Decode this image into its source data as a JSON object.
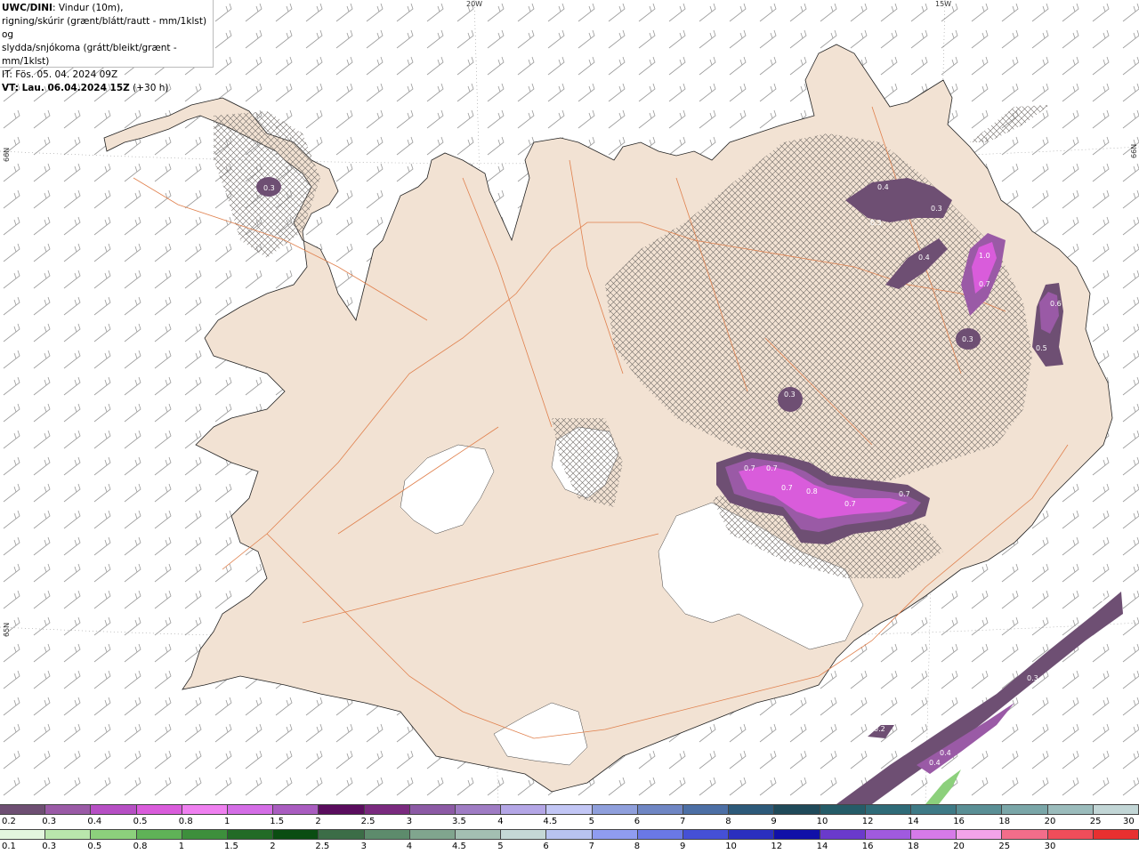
{
  "header": {
    "model": "UWC/DINI",
    "desc_1": ": Vindur (10m),",
    "desc_2": "rigning/skúrir (grænt/blátt/rautt - mm/1klst) og",
    "desc_3": "slydda/snjókoma (grátt/bleikt/grænt - mm/1klst)",
    "it": "IT: Fös. 05. 04. 2024 09Z",
    "vt_label": "VT: Lau. 06.04.2024 15Z",
    "vt_offset": " (+30 h)"
  },
  "graticule": {
    "lon_20w": "20W",
    "lon_15w": "15W",
    "lat_66n_left": "66N",
    "lat_66n_right": "66N",
    "lat_65n": "65N"
  },
  "map_labels": [
    "0.3",
    "0.4",
    "0.3",
    "0.3",
    "0.4",
    "1.0",
    "0.7",
    "0.6",
    "0.3",
    "0.5",
    "0.3",
    "0.7",
    "0.7",
    "0.7",
    "0.8",
    "0.7",
    "0.7",
    "0.2",
    "0.3",
    "0.2",
    "0.4",
    "0.4"
  ],
  "snow_scale": {
    "labels": [
      "0.2",
      "0.3",
      "0.4",
      "0.5",
      "0.8",
      "1",
      "1.5",
      "2",
      "2.5",
      "3",
      "3.5",
      "4",
      "4.5",
      "5",
      "6",
      "7",
      "8",
      "9",
      "10",
      "12",
      "14",
      "16",
      "18",
      "20",
      "25",
      "30"
    ],
    "colors": [
      "#6e4f73",
      "#9a5aa6",
      "#b64fc4",
      "#d95cdb",
      "#ef80f0",
      "#d46de6",
      "#a95cc0",
      "#5a0d5e",
      "#7a2a7f",
      "#8c5aa5",
      "#9f7cc4",
      "#b4a6e6",
      "#c2c6f5",
      "#8f9fdc",
      "#6f86c4",
      "#4c6fa5",
      "#2d5a7a",
      "#1f4a5a",
      "#255c68",
      "#2f6b78",
      "#3e7a86",
      "#5a8f95",
      "#7aa6a8",
      "#9bbcbc",
      "#c2d6d6"
    ]
  },
  "rain_scale": {
    "labels": [
      "0.1",
      "0.3",
      "0.5",
      "0.8",
      "1",
      "1.5",
      "2",
      "2.5",
      "3",
      "4",
      "4.5",
      "5",
      "6",
      "7",
      "8",
      "9",
      "10",
      "12",
      "14",
      "16",
      "18",
      "20",
      "25",
      "30"
    ],
    "colors": [
      "#e3f6de",
      "#b9e6ac",
      "#8cd07c",
      "#5fb257",
      "#3d8f3c",
      "#226b26",
      "#0b4d12",
      "#3c6d47",
      "#5d8b6c",
      "#80a58e",
      "#a3bfb2",
      "#c5d8d6",
      "#b8c3f0",
      "#8f9cf0",
      "#6a78e6",
      "#4550d6",
      "#2a2fbf",
      "#1010a8",
      "#6a3acb",
      "#a05adf",
      "#d67ae8",
      "#f3a3ea",
      "#f26d8a",
      "#f04d5a",
      "#e83030"
    ]
  }
}
